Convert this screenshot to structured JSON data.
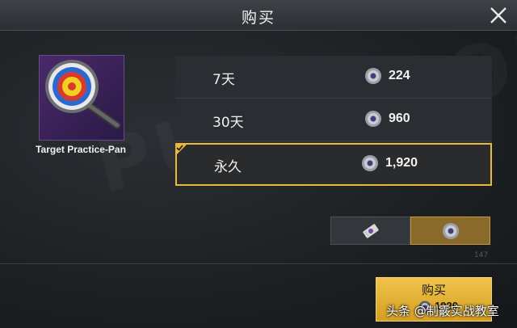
{
  "header": {
    "title": "购买",
    "close_icon": "close-icon"
  },
  "item": {
    "name": "Target Practice-Pan",
    "icon": "target-pan-icon"
  },
  "options": [
    {
      "duration": "7天",
      "price": "224",
      "selected": false
    },
    {
      "duration": "30天",
      "price": "960",
      "selected": false
    },
    {
      "duration": "永久",
      "price": "1,920",
      "selected": true
    }
  ],
  "currency_toggle": {
    "left_icon": "coupon-icon",
    "right_icon": "coin-icon",
    "selected": "right"
  },
  "purchase": {
    "label": "购买",
    "price": "1920"
  },
  "watermark": {
    "corner_text": "147",
    "credit": "头条 @制霰实战教室"
  },
  "colors": {
    "accent": "#e9b93a",
    "button": "#d49e22",
    "background": "#1c1f22"
  }
}
